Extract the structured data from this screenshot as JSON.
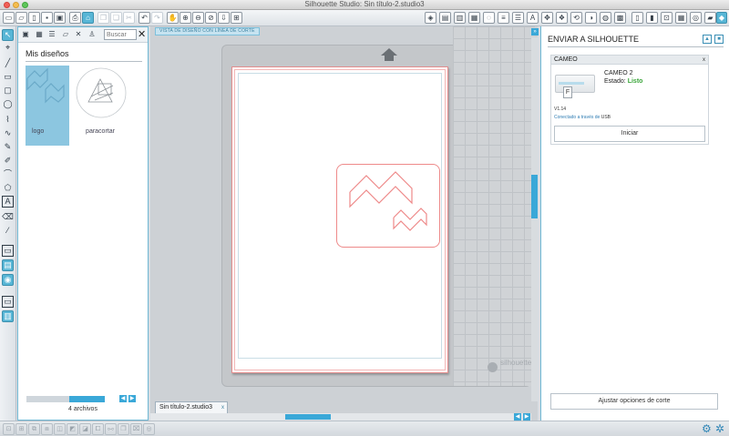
{
  "window": {
    "title": "Silhouette Studio: Sin título-2.studio3"
  },
  "toolbar": {
    "left_icons": [
      "new-document-icon",
      "open-icon",
      "library-icon",
      "save-icon",
      "save-as-icon",
      "print-icon",
      "send-to-silhouette-icon",
      "copy-icon",
      "paste-icon",
      "cut-icon",
      "undo-icon",
      "redo-icon",
      "pan-icon",
      "zoom-in-icon",
      "zoom-out-icon",
      "zoom-selected-icon",
      "zoom-fit-icon",
      "fit-page-icon"
    ],
    "right_icons": [
      "fill-color-icon",
      "line-color-icon",
      "line-style-icon",
      "fill-gradient-icon",
      "fill-pattern-icon",
      "transparency-icon",
      "line-width-icon",
      "text-style-icon",
      "align-icon",
      "replicate-icon",
      "transform-icon",
      "modify-icon",
      "offset-icon",
      "trace-icon",
      "page-setup-icon",
      "cut-settings-icon",
      "registration-icon",
      "grid-icon",
      "design-store-icon",
      "send-icon"
    ]
  },
  "left_tools": [
    "select-icon",
    "point-edit-icon",
    "line-icon",
    "rectangle-icon",
    "rounded-rectangle-icon",
    "ellipse-icon",
    "polygon-icon",
    "curve-icon",
    "arc-icon",
    "freehand-icon",
    "smooth-freehand-icon",
    "polygon-shape-icon",
    "text-icon",
    "eraser-icon",
    "knife-icon",
    "draw-mode-icon",
    "sketch-icon",
    "store-icon",
    "layers-icon",
    "panels-icon"
  ],
  "library": {
    "search_placeholder": "Buscar",
    "close": "✕",
    "section_title": "Mis diseños",
    "items": [
      {
        "label": "logo",
        "selected": true
      },
      {
        "label": "paracortar",
        "selected": false
      }
    ],
    "count": "4 archivos",
    "prev": "◀",
    "next": "▶"
  },
  "workspace": {
    "view_label": "VISTA DE DISEÑO CON LÍNEA DE CORTE",
    "doc_tab": "Sin título-2.studio3",
    "doc_tab_close": "x",
    "watermark": "silhouette",
    "collapse": "»",
    "prev": "◀",
    "next": "▶"
  },
  "send_panel": {
    "title": "ENVIAR A SILHOUETTE",
    "collapse": "▲",
    "expand": "■",
    "device_header": "CAMEO",
    "device_header_close": "x",
    "device_name": "CAMEO 2",
    "status_label": "Estado:",
    "status_value": "Listo",
    "paper_letter": "F",
    "version": "V1.14",
    "connection_label": "Conectado a través de",
    "connection_value": "USB",
    "start_button": "Iniciar",
    "adjust_button": "Ajustar opciones de corte"
  },
  "colors": {
    "accent": "#3aa8d8",
    "selection": "#8cc6e0",
    "cut_line": "#ee8a8a",
    "status_ready": "#3aa53a"
  }
}
